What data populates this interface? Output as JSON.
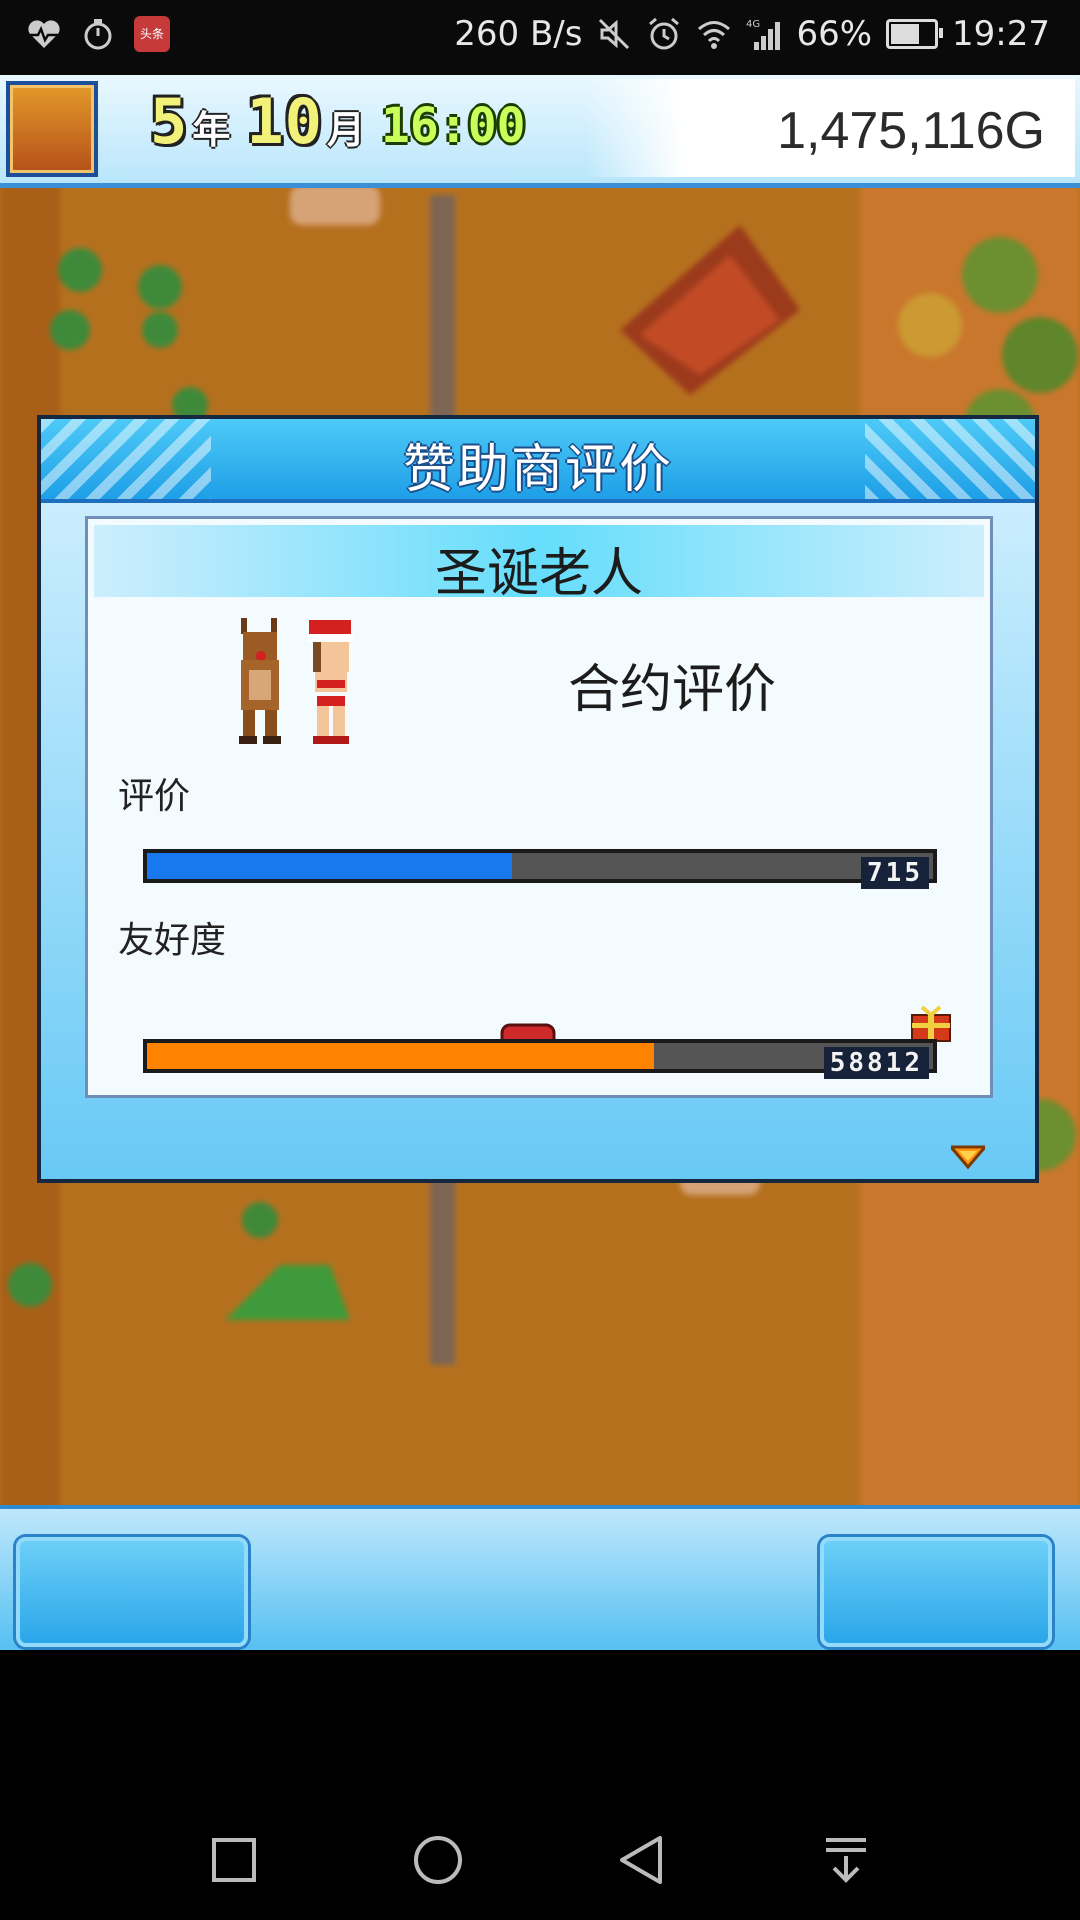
{
  "status_bar": {
    "network_speed": "260 B/s",
    "battery_percent": "66%",
    "time": "19:27",
    "icons": [
      "heart-monitor-icon",
      "timer-icon",
      "app-badge-icon",
      "mute-icon",
      "alarm-icon",
      "wifi-icon",
      "signal-4g-icon",
      "battery-icon"
    ],
    "badge_text": "头条"
  },
  "hud": {
    "year_num": "5",
    "year_unit": "年",
    "month_num": "10",
    "month_unit": "月",
    "time": "16:00",
    "money": "1,475,116G"
  },
  "dialog": {
    "title": "赞助商评价",
    "sponsor_name": "圣诞老人",
    "contract_label": "合约评价",
    "rating": {
      "label": "评价",
      "value_text": "715",
      "fill_fraction": 0.465,
      "color": "#1878ee"
    },
    "friendship": {
      "label": "友好度",
      "value_text": "58812",
      "fill_fraction": 0.645,
      "color": "#ff8200",
      "marker_fraction": 0.485
    }
  },
  "colors": {
    "accent": "#1e9fe7",
    "panel_bg": "#f3fbff"
  }
}
